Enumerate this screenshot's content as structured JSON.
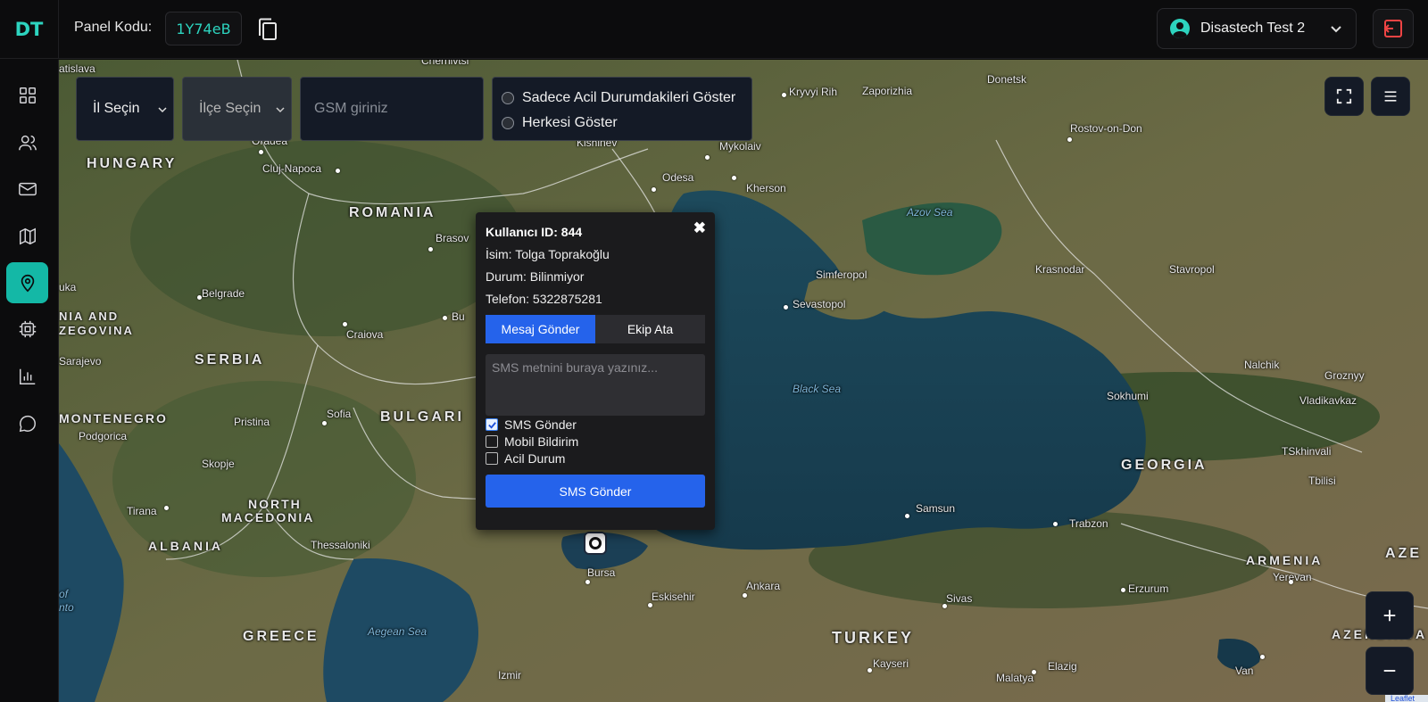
{
  "logo": "DT",
  "header": {
    "panel_label": "Panel Kodu:",
    "panel_code": "1Y74eB",
    "user_name": "Disastech Test 2"
  },
  "sidebar": {
    "items": [
      {
        "icon": "grid-icon"
      },
      {
        "icon": "users-icon"
      },
      {
        "icon": "mail-icon"
      },
      {
        "icon": "map-icon"
      },
      {
        "icon": "location-pin-icon",
        "active": true
      },
      {
        "icon": "chip-icon"
      },
      {
        "icon": "bar-chart-icon"
      },
      {
        "icon": "chat-icon"
      }
    ]
  },
  "filters": {
    "province": "İl Seçin",
    "district": "İlçe Seçin",
    "gsm_placeholder": "GSM giriniz",
    "radio_emergency": "Sadece Acil Durumdakileri Göster",
    "radio_all": "Herkesi Göster"
  },
  "map": {
    "labels": {
      "bratislava": "atislava",
      "chernivtsi": "Chernivtsi",
      "hungary": "HUNGARY",
      "oradea": "Oradea",
      "cluj": "Cluj-Napoca",
      "romania": "ROMANIA",
      "brasov": "Brasov",
      "kishinev": "Kishinev",
      "odesa": "Odesa",
      "mykolaiv": "Mykolaiv",
      "kherson": "Kherson",
      "kryvyi": "Kryvyi Rih",
      "zaporizhia": "Zaporizhia",
      "donetsk": "Donetsk",
      "rostov": "Rostov-on-Don",
      "azov": "Azov Sea",
      "simferopol": "Simferopol",
      "sevastopol": "Sevastopol",
      "krasnodar": "Krasnodar",
      "stavropol": "Stavropol",
      "uka": "uka",
      "belgrade": "Belgrade",
      "bosnia1": "NIA AND",
      "bosnia2": "ZEGOVINA",
      "sarajevo": "Sarajevo",
      "serbia": "SERBIA",
      "craiova": "Craiova",
      "bu": "Bu",
      "blacksea": "Black Sea",
      "nalchik": "Nalchik",
      "groznyy": "Groznyy",
      "sokhumi": "Sokhumi",
      "vladikavkaz": "Vladikavkaz",
      "montenegro": "MONTENEGRO",
      "pristina": "Pristina",
      "sofia": "Sofia",
      "bulgaria": "BULGARI",
      "podgorica": "Podgorica",
      "skopje": "Skopje",
      "tskhinvali": "TSkhinvali",
      "tbilisi": "Tbilisi",
      "georgia": "GEORGIA",
      "north1": "NORTH",
      "north2": "MACEDONIA",
      "tirana": "Tirana",
      "samsun": "Samsun",
      "trabzon": "Trabzon",
      "albania": "ALBANIA",
      "thessaloniki": "Thessaloniki",
      "armenia": "ARMENIA",
      "yerevan": "Yerevan",
      "aze": "AZE",
      "bursa": "Bursa",
      "ankara": "Ankara",
      "eskisehir": "Eskisehir",
      "sivas": "Sivas",
      "erzurum": "Erzurum",
      "azerbaija": "AZERBAIJA",
      "aegean": "Aegean Sea",
      "greece": "GREECE",
      "turkey": "TURKEY",
      "kayseri": "Kayseri",
      "malatya": "Malatya",
      "elazig": "Elazig",
      "van": "Van",
      "izmir": "Izmir",
      "ionian1": "of",
      "ionian2": "nto"
    },
    "attribution": "Leaflet"
  },
  "popup": {
    "user_id": "Kullanıcı ID: 844",
    "name": "İsim: Tolga Toprakoğlu",
    "status": "Durum: Bilinmiyor",
    "phone": "Telefon: 5322875281",
    "tab_message": "Mesaj Gönder",
    "tab_team": "Ekip Ata",
    "sms_placeholder": "SMS metnini buraya yazınız...",
    "chk_sms": "SMS Gönder",
    "chk_mobile": "Mobil Bildirim",
    "chk_emergency": "Acil Durum",
    "send_label": "SMS Gönder"
  },
  "colors": {
    "accent": "#14b8a6",
    "accent_text": "#2dd4bf",
    "primary": "#2563eb",
    "logout": "#ef4444"
  }
}
